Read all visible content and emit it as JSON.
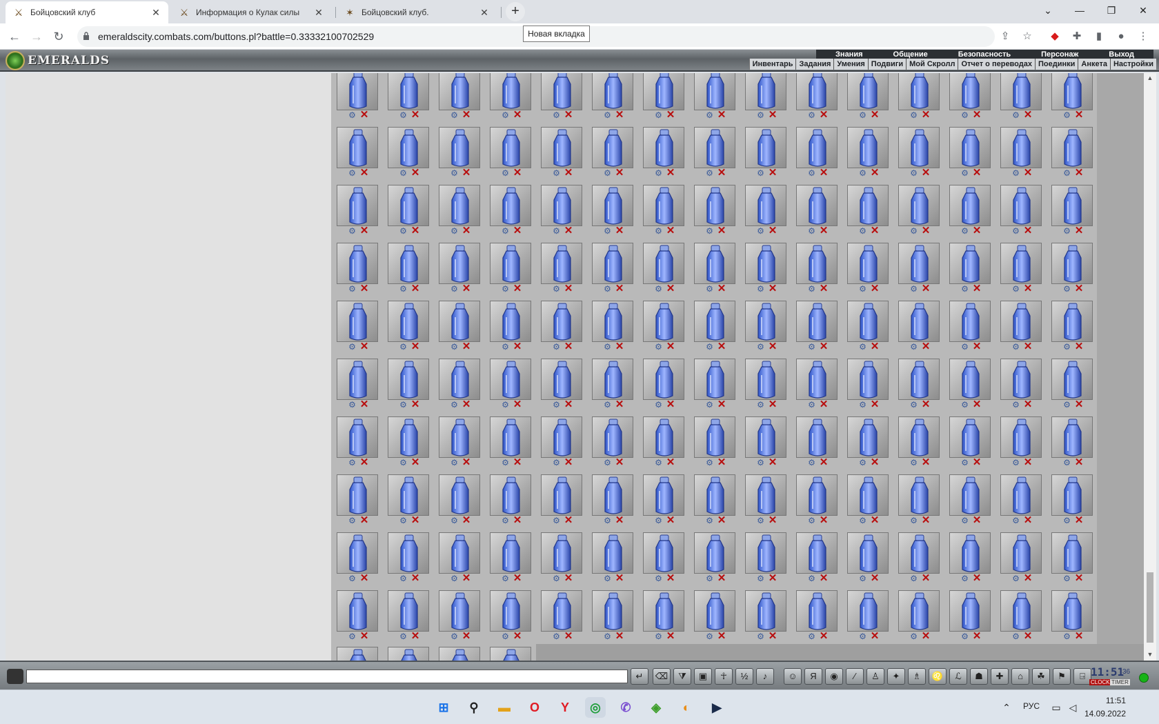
{
  "browser": {
    "tabs": [
      {
        "title": "Бойцовский клуб",
        "icon": "crossed-swords-icon",
        "active": true
      },
      {
        "title": "Информация о Кулак силы",
        "icon": "crossed-swords-icon",
        "active": false
      },
      {
        "title": "Бойцовский клуб.",
        "icon": "warrior-icon",
        "active": false
      }
    ],
    "new_tab_tooltip": "Новая вкладка",
    "url": "emeraldscity.combats.com/buttons.pl?battle=0.33332100702529"
  },
  "game": {
    "logo_text": "EMERALDS",
    "top_menu": [
      "Знания",
      "Общение",
      "Безопасность",
      "Персонаж",
      "Выход"
    ],
    "sub_menu": [
      "Инвентарь",
      "Задания",
      "Умения",
      "Подвиги",
      "Мой Скролл",
      "Отчет о переводах",
      "Поединки",
      "Анкета",
      "Настройки"
    ],
    "inventory": {
      "item_icon": "blue-potion-bottle-icon",
      "columns": 15,
      "full_rows": 10,
      "partial_row_count": 4,
      "actions": [
        "use-icon",
        "delete-icon"
      ]
    }
  },
  "chat": {
    "input_value": "",
    "clock_time": "11:51",
    "clock_seconds": "36",
    "clock_label": "CLOCK",
    "timer_label": "TIMER",
    "status_color": "#17b317"
  },
  "taskbar": {
    "lang": "РУС",
    "time": "11:51",
    "date": "14.09.2022"
  }
}
